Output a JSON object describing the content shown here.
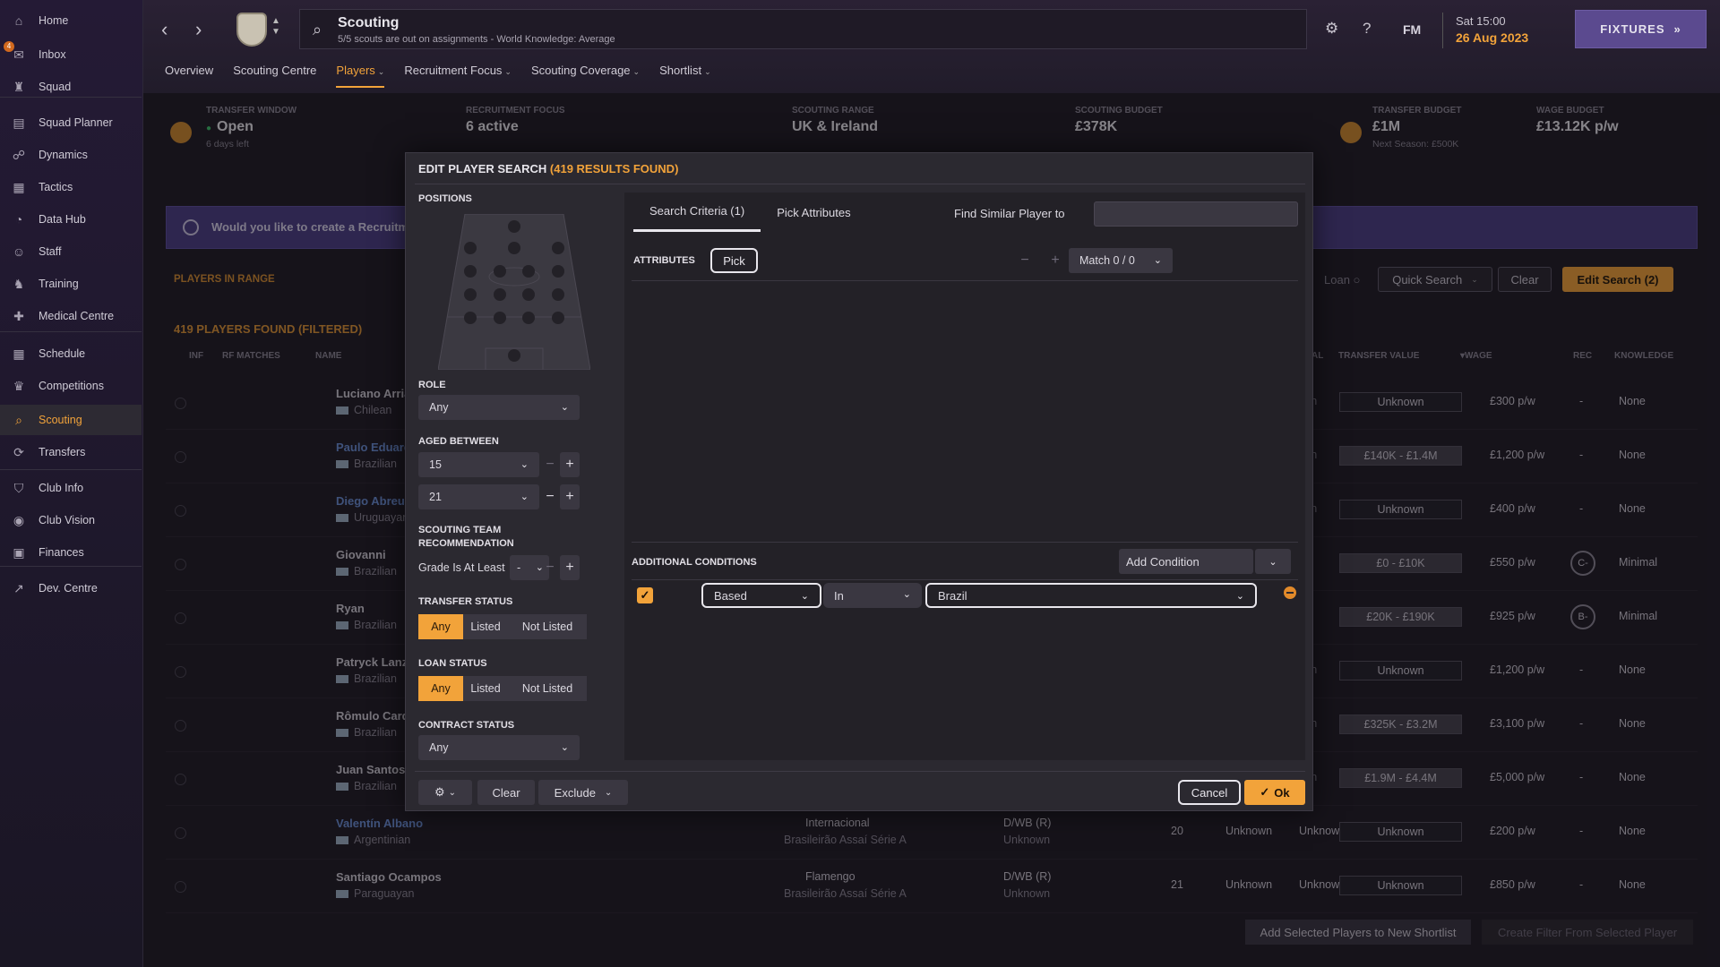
{
  "sidebar": {
    "items": [
      {
        "label": "Home",
        "icon": "home-icon"
      },
      {
        "label": "Inbox",
        "icon": "inbox-icon",
        "badge": "4"
      },
      {
        "label": "Squad",
        "icon": "shirt-icon"
      },
      {
        "label": "Squad Planner",
        "icon": "planner-icon"
      },
      {
        "label": "Dynamics",
        "icon": "people-icon"
      },
      {
        "label": "Tactics",
        "icon": "board-icon"
      },
      {
        "label": "Data Hub",
        "icon": "chart-icon"
      },
      {
        "label": "Staff",
        "icon": "staff-icon"
      },
      {
        "label": "Training",
        "icon": "training-icon"
      },
      {
        "label": "Medical Centre",
        "icon": "medical-icon"
      },
      {
        "label": "Schedule",
        "icon": "calendar-icon"
      },
      {
        "label": "Competitions",
        "icon": "trophy-icon"
      },
      {
        "label": "Scouting",
        "icon": "search-icon",
        "active": true
      },
      {
        "label": "Transfers",
        "icon": "transfer-icon"
      },
      {
        "label": "Club Info",
        "icon": "shield-icon"
      },
      {
        "label": "Club Vision",
        "icon": "vision-icon"
      },
      {
        "label": "Finances",
        "icon": "money-icon"
      },
      {
        "label": "Dev. Centre",
        "icon": "growth-icon"
      }
    ]
  },
  "header": {
    "title": "Scouting",
    "subtitle": "5/5 scouts are out on assignments - World Knowledge: Average",
    "logo": "FM",
    "time": "Sat 15:00",
    "date": "26 Aug 2023",
    "fixtures": "FIXTURES",
    "tabs": [
      {
        "label": "Overview",
        "dropdown": false
      },
      {
        "label": "Scouting Centre",
        "dropdown": false
      },
      {
        "label": "Players",
        "dropdown": true,
        "active": true
      },
      {
        "label": "Recruitment Focus",
        "dropdown": true
      },
      {
        "label": "Scouting Coverage",
        "dropdown": true
      },
      {
        "label": "Shortlist",
        "dropdown": true
      }
    ]
  },
  "stats": {
    "transfer_window": {
      "label": "TRANSFER WINDOW",
      "value": "Open",
      "sub": "6 days left"
    },
    "recruitment_focus": {
      "label": "RECRUITMENT FOCUS",
      "value": "6 active"
    },
    "scouting_range": {
      "label": "SCOUTING RANGE",
      "value": "UK & Ireland"
    },
    "scouting_budget": {
      "label": "SCOUTING BUDGET",
      "value": "£378K"
    },
    "transfer_budget": {
      "label": "TRANSFER BUDGET",
      "value": "£1M",
      "sub": "Next Season: £500K"
    },
    "wage_budget": {
      "label": "WAGE BUDGET",
      "value": "£13.12K p/w"
    }
  },
  "banner": {
    "text": "Would you like to create a Recruitme"
  },
  "players_section": {
    "title": "PLAYERS IN RANGE",
    "results": "419 PLAYERS FOUND (FILTERED)",
    "loan": "Loan",
    "quick_search": "Quick Search",
    "clear": "Clear",
    "edit_search": "Edit Search (2)"
  },
  "columns": {
    "inf": "INF",
    "rf_matches": "RF MATCHES",
    "name": "NAME",
    "al": "AL",
    "transfer_value": "TRANSFER VALUE",
    "wage": "WAGE",
    "rec": "REC",
    "knowledge": "KNOWLEDGE"
  },
  "players": [
    {
      "name": "Luciano Arria",
      "nat": "Chilean",
      "link": false,
      "pnow": "vn",
      "tv": "Unknown",
      "range": false,
      "wage": "£300 p/w",
      "rec": "-",
      "know": "None"
    },
    {
      "name": "Paulo Eduard",
      "nat": "Brazilian",
      "link": true,
      "pnow": "vn",
      "tv": "£140K - £1.4M",
      "range": true,
      "wage": "£1,200 p/w",
      "rec": "-",
      "know": "None"
    },
    {
      "name": "Diego Abreu",
      "nat": "Uruguayan",
      "link": true,
      "pnow": "vn",
      "tv": "Unknown",
      "range": false,
      "wage": "£400 p/w",
      "rec": "-",
      "know": "None"
    },
    {
      "name": "Giovanni",
      "nat": "Brazilian",
      "link": false,
      "pnow": "",
      "tv": "£0 - £10K",
      "range": true,
      "wage": "£550 p/w",
      "rec": "C-",
      "know": "Minimal"
    },
    {
      "name": "Ryan",
      "nat": "Brazilian",
      "link": false,
      "pnow": "",
      "tv": "£20K - £190K",
      "range": true,
      "wage": "£925 p/w",
      "rec": "B-",
      "know": "Minimal"
    },
    {
      "name": "Patryck Lanz",
      "nat": "Brazilian",
      "link": false,
      "pnow": "vn",
      "tv": "Unknown",
      "range": false,
      "wage": "£1,200 p/w",
      "rec": "-",
      "know": "None"
    },
    {
      "name": "Rômulo Card",
      "nat": "Brazilian",
      "link": false,
      "pnow": "vn",
      "tv": "£325K - £3.2M",
      "range": true,
      "wage": "£3,100 p/w",
      "rec": "-",
      "know": "None"
    },
    {
      "name": "Juan Santos",
      "nat": "Brazilian",
      "link": false,
      "pnow": "vn",
      "tv": "£1.9M - £4.4M",
      "range": true,
      "wage": "£5,000 p/w",
      "rec": "-",
      "know": "None"
    },
    {
      "name": "Valentín Albano",
      "nat": "Argentinian",
      "link": true,
      "club": "Internacional",
      "league": "Brasileirão Assaí Série A",
      "pos": "D/WB (R)",
      "posb": "Unknown",
      "age": "20",
      "u1": "Unknown",
      "u2": "Unknown",
      "tv": "Unknown",
      "range": false,
      "wage": "£200 p/w",
      "rec": "-",
      "know": "None"
    },
    {
      "name": "Santiago Ocampos",
      "nat": "Paraguayan",
      "link": false,
      "club": "Flamengo",
      "league": "Brasileirão Assaí Série A",
      "pos": "D/WB (R)",
      "posb": "Unknown",
      "age": "21",
      "u1": "Unknown",
      "u2": "Unknown",
      "tv": "Unknown",
      "range": false,
      "wage": "£850 p/w",
      "rec": "-",
      "know": "None"
    }
  ],
  "bottom": {
    "add_shortlist": "Add Selected Players to New Shortlist",
    "create_filter": "Create Filter From Selected Player"
  },
  "modal": {
    "title": "EDIT PLAYER SEARCH",
    "results": "(419 RESULTS FOUND)",
    "positions_label": "POSITIONS",
    "role_label": "ROLE",
    "role_value": "Any",
    "aged_label": "AGED BETWEEN",
    "age_min": "15",
    "age_max": "21",
    "str_label": "SCOUTING TEAM RECOMMENDATION",
    "grade_label": "Grade Is At Least",
    "grade_value": "-",
    "transfer_status_label": "TRANSFER STATUS",
    "loan_status_label": "LOAN STATUS",
    "status_options": [
      "Any",
      "Listed",
      "Not Listed"
    ],
    "contract_label": "CONTRACT STATUS",
    "contract_value": "Any",
    "tab_criteria": "Search Criteria (1)",
    "tab_attributes": "Pick Attributes",
    "find_similar": "Find Similar Player to",
    "attributes_label": "ATTRIBUTES",
    "pick": "Pick",
    "match": "Match 0 / 0",
    "additional_label": "ADDITIONAL CONDITIONS",
    "add_condition": "Add Condition",
    "cond_field": "Based",
    "cond_op": "In",
    "cond_value": "Brazil",
    "clear": "Clear",
    "exclude": "Exclude",
    "cancel": "Cancel",
    "ok": "Ok"
  }
}
